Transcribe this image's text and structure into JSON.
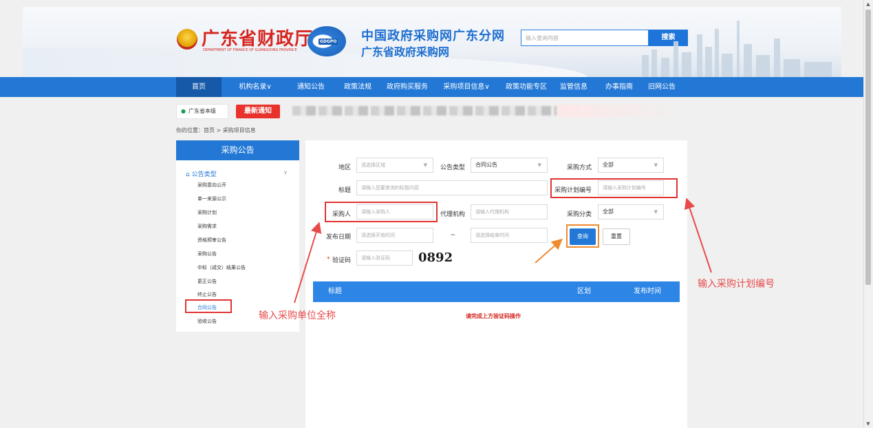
{
  "header": {
    "title_cn": "广东省财政厅",
    "title_en": "DEPARTMENT OF FINANCE OF GUANGDONG PROVINCE",
    "logo_text": "GDGPO",
    "gov_title_1": "中国政府采购网广东分网",
    "gov_title_2": "广东省政府采购网",
    "search_placeholder": "输入查询内容",
    "search_button": "搜索"
  },
  "nav": {
    "items": [
      "首页",
      "机构名录∨",
      "通知公告",
      "政策法规",
      "政府购买服务",
      "采购项目信息∨",
      "政策功能专区",
      "监管信息",
      "办事指南",
      "旧网公告"
    ]
  },
  "notice": {
    "location": "广东省本级",
    "latest_badge": "最新通知"
  },
  "breadcrumb": "你的位置：首页 > 采购项目信息",
  "sidebar": {
    "title": "采购公告",
    "group": "公告类型",
    "items": [
      "采购意向公开",
      "单一来源公示",
      "采购计划",
      "采购需求",
      "资格预审公告",
      "采购公告",
      "中标（成交）结果公告",
      "更正公告",
      "终止公告",
      "合同公告",
      "验收公告"
    ]
  },
  "form": {
    "region_label": "地区",
    "region_placeholder": "请选择区域",
    "notice_type_label": "公告类型",
    "notice_type_value": "合同公告",
    "method_label": "采购方式",
    "method_value": "全部",
    "title_label": "标题",
    "title_placeholder": "请输入您要查询的标题内容",
    "plan_no_label": "采购计划编号",
    "plan_no_placeholder": "请输入采购计划编号",
    "buyer_label": "采购人",
    "buyer_placeholder": "请输入采购人",
    "agency_label": "代理机构",
    "agency_placeholder": "请输入代理机构",
    "category_label": "采购分类",
    "category_value": "全部",
    "date_label": "发布日期",
    "date_start_placeholder": "请选择开始时间",
    "date_sep": "~",
    "date_end_placeholder": "请选择结束时间",
    "query_button": "查询",
    "reset_button": "重置",
    "captcha_label": "验证码",
    "captcha_placeholder": "请输入验证码",
    "captcha_text": "0892",
    "required_mark": "*"
  },
  "table": {
    "col_title": "标题",
    "col_region": "区划",
    "col_date": "发布时间",
    "message": "请完成上方验证码操作"
  },
  "annotations": {
    "buyer_hint": "输入采购单位全称",
    "plan_hint": "输入采购计划编号"
  },
  "colors": {
    "primary": "#2378d6",
    "annotation_red": "#e84a4a",
    "arrow_orange": "#f08a30"
  }
}
